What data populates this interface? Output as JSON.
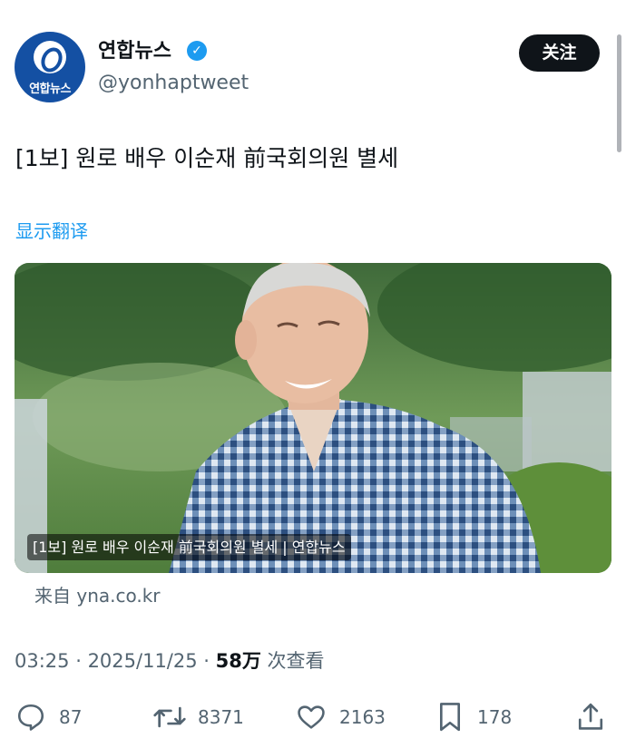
{
  "account": {
    "logo_text": "연합뉴스",
    "display_name": "연합뉴스",
    "verified_mark": "✓",
    "handle": "@yonhaptweet",
    "follow_label": "关注"
  },
  "tweet": {
    "text": "[1보] 원로 배우 이순재 前국회의원 별세",
    "translate_label": "显示翻译",
    "media_caption": "[1보] 원로 배우 이순재 前국회의원 별세 | 연합뉴스",
    "source": "来自 yna.co.kr",
    "time": "03:25",
    "sep1": " · ",
    "date": "2025/11/25",
    "sep2": " · ",
    "views": "58万",
    "views_suffix": " 次查看"
  },
  "actions": {
    "replies": "87",
    "reposts": "8371",
    "likes": "2163",
    "bookmarks": "178"
  },
  "colors": {
    "accent": "#1d9bf0",
    "text": "#0f1419",
    "muted": "#536471",
    "logo_bg": "#1450a3"
  },
  "icons": [
    "reply-icon",
    "repost-icon",
    "like-icon",
    "bookmark-icon",
    "share-icon",
    "verified-badge-icon"
  ]
}
